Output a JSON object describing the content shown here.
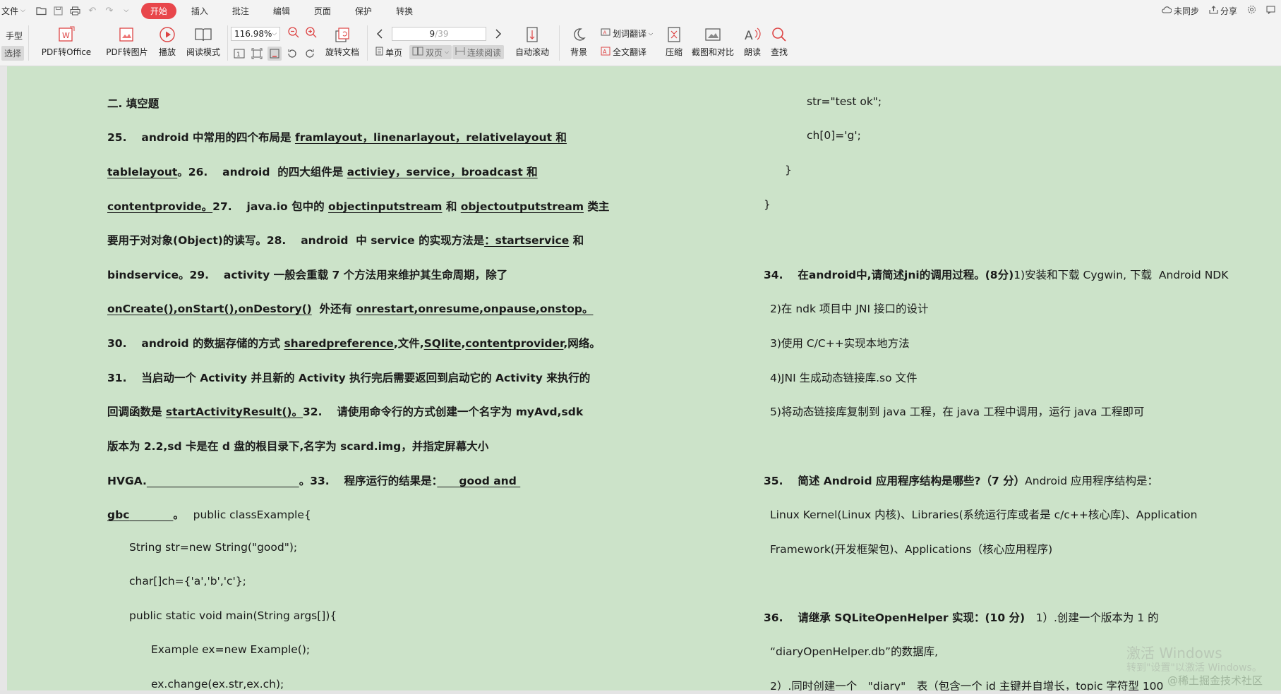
{
  "menubar": {
    "file_label": "文件",
    "tabs": [
      "开始",
      "插入",
      "批注",
      "编辑",
      "页面",
      "保护",
      "转换"
    ],
    "active_tab": "开始",
    "sync_label": "未同步",
    "share_label": "分享"
  },
  "ribbon": {
    "hand_label": "手型",
    "select_label": "选择",
    "pdf_to_office": "PDF转Office",
    "pdf_to_image": "PDF转图片",
    "play": "播放",
    "read_mode": "阅读模式",
    "zoom_value": "116.98%",
    "rotate_doc": "旋转文档",
    "page_current": "9",
    "page_total": "/39",
    "single_page": "单页",
    "double_page": "双页",
    "continuous": "连续阅读",
    "auto_scroll": "自动滚动",
    "background": "背景",
    "word_translate": "划词翻译",
    "full_translate": "全文翻译",
    "compress": "压缩",
    "screenshot_compare": "截图和对比",
    "read_aloud": "朗读",
    "find": "查找"
  },
  "document": {
    "left": {
      "l1": "二. 填空题",
      "l2a": "25.　 android 中常用的四个布局是 ",
      "l2b": "framlayout，linenarlayout，relativelayout 和",
      "l3a": "tablelayout",
      "l3b": "。26.　 android  的四大组件是 ",
      "l3c": "activiey，service，broadcast 和",
      "l4a": "contentprovide。",
      "l4b": "27.　 java.io 包中的 ",
      "l4c": "objectinputstream",
      "l4d": " 和 ",
      "l4e": "objectoutputstream",
      "l4f": " 类主",
      "l5a": "要用于对对象(Object)的读写。28.　 android  中 service 的实现方法是",
      "l5b": "：startservice",
      "l5c": " 和",
      "l6": "bindservice。29.　 activity 一般会重载 7 个方法用来维护其生命周期，除了",
      "l7a": "onCreate(),onStart(),onDestory()",
      "l7b": "  外还有 ",
      "l7c": "onrestart,onresume,onpause,onstop。",
      "l8a": "30.　 android 的数据存储的方式 ",
      "l8b": "sharedpreference",
      "l8c": ",文件,",
      "l8d": "SQlite",
      "l8e": ",",
      "l8f": "contentprovider",
      "l8g": ",网络。",
      "l9": "31.　 当启动一个 Activity 并且新的 Activity 执行完后需要返回到启动它的 Activity 来执行的",
      "l10a": "回调函数是 ",
      "l10b": "startActivityResult()。",
      "l10c": "32.　 请使用命令行的方式创建一个名字为 myAvd,sdk",
      "l11": "版本为 2.2,sd 卡是在 d 盘的根目录下,名字为 scard.img，并指定屏幕大小",
      "l12a": "HVGA.",
      "l12b": "                                        ",
      "l12c": "。33.　 程序运行的结果是：",
      "l12d": "　　good and ",
      "l13a": "gbc",
      "l13b": "　　　　",
      "l13c": "。",
      "l13d": "　 public classExample{",
      "l14": "String str=new String(\"good\");",
      "l15": "char[]ch={'a','b','c'};",
      "l16": "public static void main(String args[]){",
      "l17": "Example ex=new Example();",
      "l18": "ex.change(ex.str,ex.ch);"
    },
    "right": {
      "r1": "str=\"test ok\";",
      "r2": "ch[0]='g';",
      "r3": "}",
      "r4": "}",
      "r5a": "34.　 在android中,请简述jni的调用过程。(8分)",
      "r5b": "1)安装和下载 Cygwin, 下载  Android NDK",
      "r6": "2)在 ndk 项目中 JNI 接口的设计",
      "r7": "3)使用 C/C++实现本地方法",
      "r8": "4)JNI 生成动态链接库.so 文件",
      "r9": "5)将动态链接库复制到 java 工程，在 java 工程中调用，运行 java 工程即可",
      "r10a": "35.　 简述 Android 应用程序结构是哪些?（7 分）",
      "r10b": "Android 应用程序结构是：",
      "r11": "Linux Kernel(Linux 内核)、Libraries(系统运行库或者是 c/c++核心库)、Application",
      "r12": "Framework(开发框架包)、Applications（核心应用程序)",
      "r13a": "36.　 请继承 SQLiteOpenHelper 实现：(10 分)",
      "r13b": "　1）.创建一个版本为 1 的",
      "r14": "“diaryOpenHelper.db”的数据库,",
      "r15": "2）.同时创建一个　\"diary\"　表（包含一个 id 主键并自增长，topic 字符型 100"
    },
    "watermark": {
      "title": "激活 Windows",
      "subtitle": "转到\"设置\"以激活 Windows。",
      "source": "@稀土掘金技术社区"
    }
  },
  "colors": {
    "doc_background": "#cce3c9",
    "active_tab": "#e8464b"
  }
}
